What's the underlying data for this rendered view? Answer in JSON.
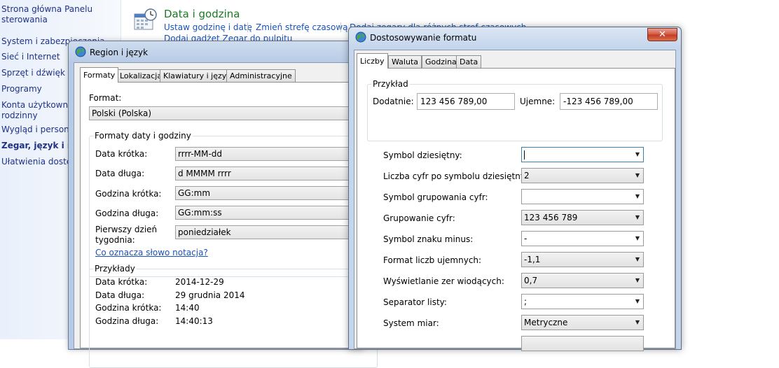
{
  "sidebar": {
    "items": [
      {
        "label": "Strona główna Panelu"
      },
      {
        "label": "sterowania"
      },
      {
        "label": "System i zabezpieczenia"
      },
      {
        "label": "Sieć i Internet"
      },
      {
        "label": "Sprzęt i dźwięk"
      },
      {
        "label": "Programy"
      },
      {
        "label": "Konta użytkowników"
      },
      {
        "label": "rodzinny"
      },
      {
        "label": "Wygląd i personalizacja"
      },
      {
        "label": "Zegar, język i region"
      },
      {
        "label": "Ułatwienia dostępu"
      }
    ]
  },
  "section": {
    "title": "Data i godzina",
    "links": [
      "Ustaw godzinę i datę",
      "Zmień strefę czasową",
      "Dodaj zegary dla różnych stref czasowych"
    ],
    "link2": "Dodaj gadżet Zegar do pulpitu"
  },
  "region": {
    "title": "Region i język",
    "tabs": [
      "Formaty",
      "Lokalizacja",
      "Klawiatury i języki",
      "Administracyjne"
    ],
    "format_label": "Format:",
    "format_value": "Polski (Polska)",
    "group_title": "Formaty daty i godziny",
    "rows": [
      {
        "label": "Data krótka:",
        "value": "rrrr-MM-dd"
      },
      {
        "label": "Data długa:",
        "value": "d MMMM rrrr"
      },
      {
        "label": "Godzina krótka:",
        "value": "GG:mm"
      },
      {
        "label": "Godzina długa:",
        "value": "GG:mm:ss"
      },
      {
        "label": "Pierwszy dzień",
        "label2": "tygodnia:",
        "value": "poniedziałek"
      }
    ],
    "help_link": "Co oznacza słowo notacja?",
    "examples_title": "Przykłady",
    "examples": [
      {
        "label": "Data krótka:",
        "value": "2014-12-29"
      },
      {
        "label": "Data długa:",
        "value": "29 grudnia 2014"
      },
      {
        "label": "Godzina krótka:",
        "value": "14:40"
      },
      {
        "label": "Godzina długa:",
        "value": "14:40:13"
      }
    ]
  },
  "format_dialog": {
    "title": "Dostosowywanie formatu",
    "close_glyph": "✕",
    "tabs": [
      "Liczby",
      "Waluta",
      "Godzina",
      "Data"
    ],
    "example_title": "Przykład",
    "positive_label": "Dodatnie:",
    "positive_value": "123 456 789,00",
    "negative_label": "Ujemne:",
    "negative_value": "-123 456 789,00",
    "rows": [
      {
        "label": "Symbol dziesiętny:",
        "value": ""
      },
      {
        "label": "Liczba cyfr po symbolu dziesiętnym:",
        "value": "2"
      },
      {
        "label": "Symbol grupowania cyfr:",
        "value": ""
      },
      {
        "label": "Grupowanie cyfr:",
        "value": "123 456 789"
      },
      {
        "label": "Symbol znaku minus:",
        "value": "-"
      },
      {
        "label": "Format liczb ujemnych:",
        "value": "-1,1"
      },
      {
        "label": "Wyświetlanie zer wiodących:",
        "value": "0,7"
      },
      {
        "label": "Separator listy:",
        "value": ";"
      },
      {
        "label": "System miar:",
        "value": "Metryczne"
      }
    ]
  }
}
